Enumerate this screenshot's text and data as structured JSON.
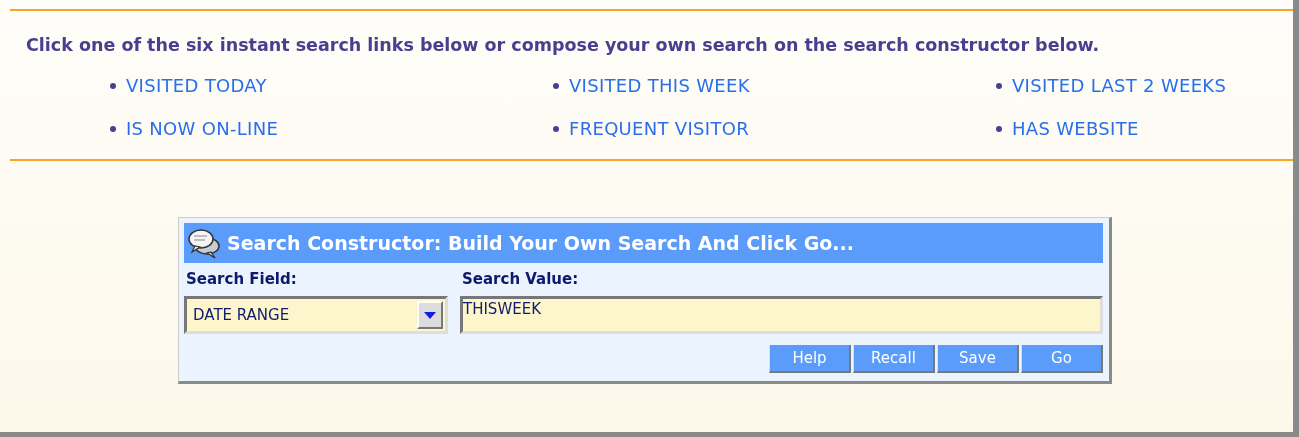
{
  "intro": "Click one of the six instant search links below or compose your own search on the search constructor below.",
  "links": [
    "VISITED TODAY",
    "VISITED THIS WEEK",
    "VISITED LAST 2 WEEKS",
    "IS NOW ON-LINE",
    "FREQUENT VISITOR",
    "HAS WEBSITE"
  ],
  "constructor": {
    "title": "Search Constructor: Build Your Own Search And Click Go...",
    "field_label": "Search Field:",
    "field_value": "DATE RANGE",
    "value_label": "Search Value:",
    "value": "THISWEEK",
    "buttons": [
      "Help",
      "Recall",
      "Save",
      "Go"
    ]
  }
}
